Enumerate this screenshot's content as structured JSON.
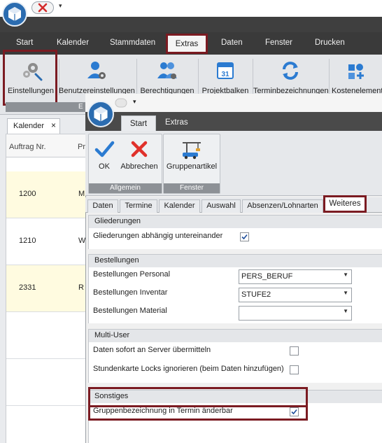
{
  "menu": {
    "items": [
      "Start",
      "Kalender",
      "Stammdaten",
      "Extras",
      "Daten",
      "Fenster",
      "Drucken"
    ]
  },
  "ribbon": {
    "buttons": [
      "Einstellungen",
      "Benutzereinstellungen",
      "Berechtigungen",
      "Projektbalken",
      "Terminbezeichnungen",
      "Kostenelement"
    ],
    "group_fragment": "E"
  },
  "left_panel": {
    "tab_label": "Kalender",
    "tab_close": "×",
    "columns": [
      "Auftrag Nr.",
      "Pr"
    ],
    "rows": [
      {
        "nr": "1200",
        "c2": "M"
      },
      {
        "nr": "1210",
        "c2": "W"
      },
      {
        "nr": "2331",
        "c2": "R"
      }
    ]
  },
  "dialog": {
    "tabs": [
      "Start",
      "Extras"
    ],
    "groups": {
      "allgemein": "Allgemein",
      "fenster": "Fenster"
    },
    "buttons": {
      "ok": "OK",
      "abbrechen": "Abbrechen",
      "gruppenartikel": "Gruppenartikel"
    },
    "subtabs": [
      "Daten",
      "Termine",
      "Kalender",
      "Auswahl",
      "Absenzen/Lohnarten",
      "Weiteres"
    ],
    "sections": {
      "gliederungen": {
        "title": "Gliederungen",
        "row": "Gliederungen abhängig untereinander",
        "checked": true
      },
      "bestellungen": {
        "title": "Bestellungen",
        "personal_label": "Bestellungen Personal",
        "personal_value": "PERS_BERUF",
        "inventar_label": "Bestellungen Inventar",
        "inventar_value": "STUFE2",
        "material_label": "Bestellungen Material",
        "material_value": ""
      },
      "multiuser": {
        "title": "Multi-User",
        "row1": "Daten sofort an Server übermitteln",
        "row1_checked": false,
        "row2": "Stundenkarte Locks ignorieren (beim Daten hinzufügen)",
        "row2_checked": false
      },
      "sonstiges": {
        "title": "Sonstiges",
        "row": "Gruppenbezeichnung in Termin änderbar",
        "checked": true
      }
    }
  },
  "colors": {
    "highlight": "#7b1b22",
    "accent_blue": "#2b6cb0",
    "menu_dark": "#3a3a3a"
  }
}
